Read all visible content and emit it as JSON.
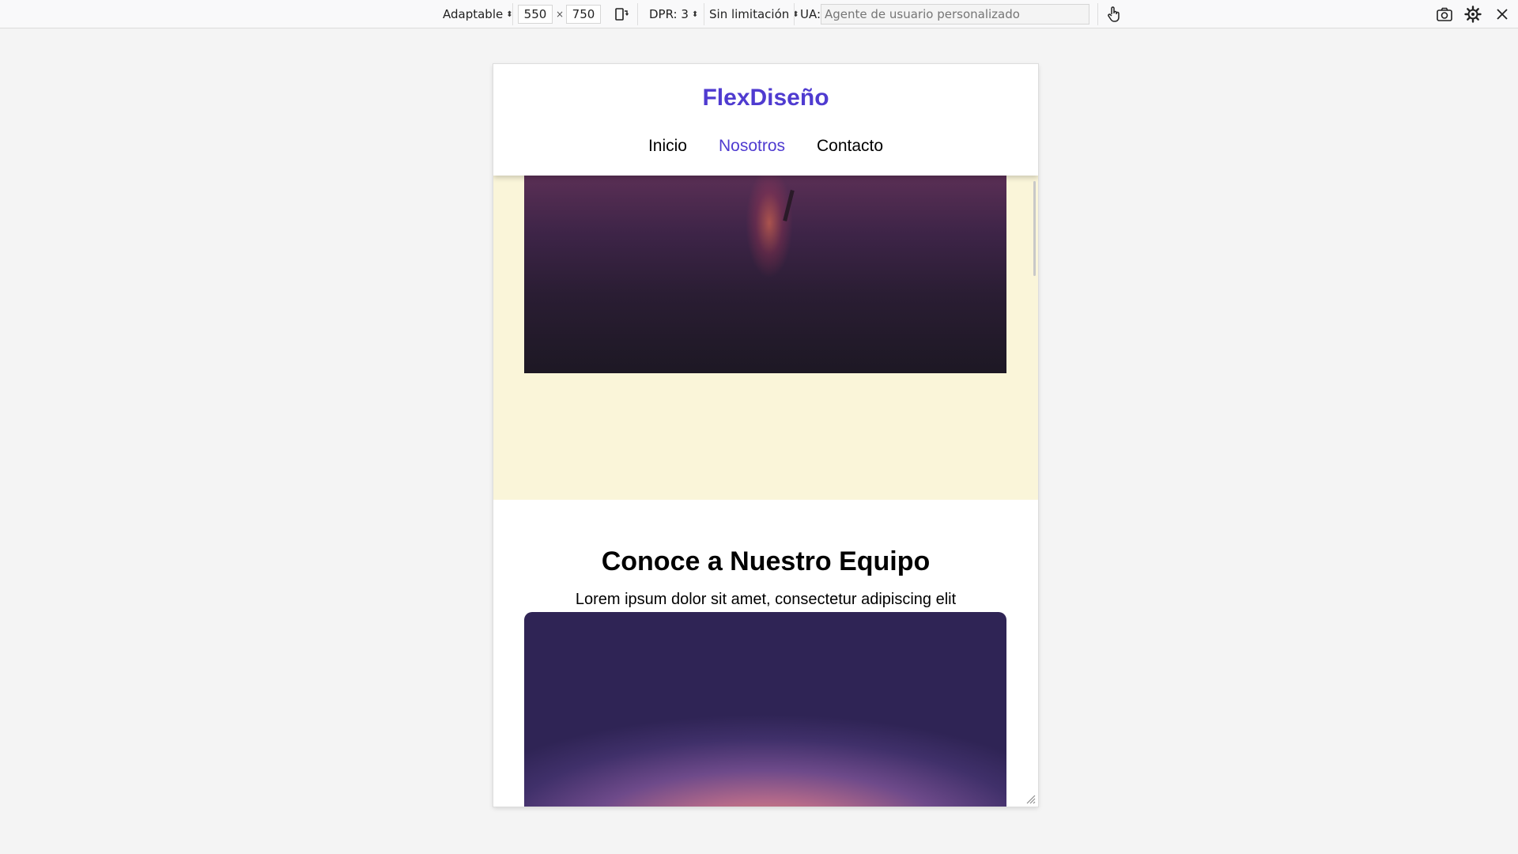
{
  "toolbar": {
    "device_select": "Adaptable",
    "width": "550",
    "times": "×",
    "height": "750",
    "dpr_select": "DPR: 3",
    "throttle_select": "Sin limitación",
    "ua_label": "UA:",
    "ua_placeholder": "Agente de usuario personalizado"
  },
  "site": {
    "brand": "FlexDiseño",
    "nav": [
      {
        "label": "Inicio",
        "active": false
      },
      {
        "label": "Nosotros",
        "active": true
      },
      {
        "label": "Contacto",
        "active": false
      }
    ],
    "team_title": "Conoce a Nuestro Equipo",
    "team_subtitle": "Lorem ipsum dolor sit amet, consectetur adipiscing elit"
  },
  "colors": {
    "accent": "#4f3bd0",
    "hero_band": "#faf5d9"
  },
  "icons": {
    "rotate": "rotate-device-icon",
    "touch": "touch-simulation-icon",
    "screenshot": "screenshot-icon",
    "settings": "gear-icon",
    "close": "close-icon"
  }
}
